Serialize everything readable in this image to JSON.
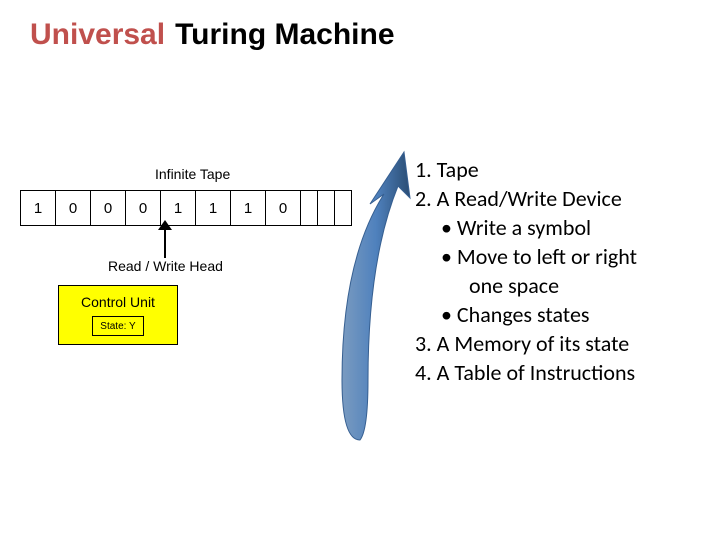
{
  "title": {
    "universal": "Universal",
    "rest": "Turing Machine"
  },
  "diagram": {
    "infinite_tape_label": "Infinite Tape",
    "tape_cells": [
      "1",
      "0",
      "0",
      "0",
      "1",
      "1",
      "1",
      "0",
      "",
      "",
      ""
    ],
    "rw_head_label": "Read / Write Head",
    "control_unit_label": "Control Unit",
    "state_label": "State: Y"
  },
  "list": {
    "l1": "1. Tape",
    "l2": "2. A Read/Write Device",
    "l2a": "• Write a symbol",
    "l2b": "• Move to left or right",
    "l2b_cont": "one space",
    "l2c": "• Changes states",
    "l3": "3. A Memory of its state",
    "l4": "4. A Table of Instructions"
  }
}
